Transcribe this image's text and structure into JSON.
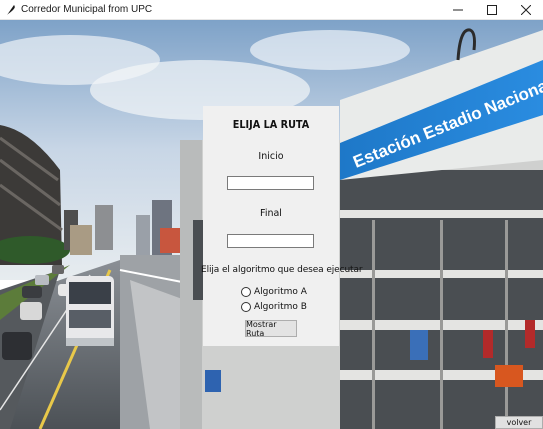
{
  "window": {
    "title": "Corredor Municipal from UPC",
    "icons": [
      "feather-icon",
      "minimize-icon",
      "maximize-icon",
      "close-icon"
    ]
  },
  "background": {
    "sign_text": "Estación Estadio Nacional",
    "sign_color": "#1f7fd0"
  },
  "panel": {
    "title": "ELIJA LA RUTA",
    "start_label": "Inicio",
    "start_value": "",
    "end_label": "Final",
    "end_value": "",
    "algorithm_label": "Elija el algoritmo que desea ejecutar",
    "options": [
      "Algoritmo A",
      "Algoritmo B"
    ],
    "show_button": "Mostrar Ruta"
  },
  "footer": {
    "back_button": "volver"
  }
}
